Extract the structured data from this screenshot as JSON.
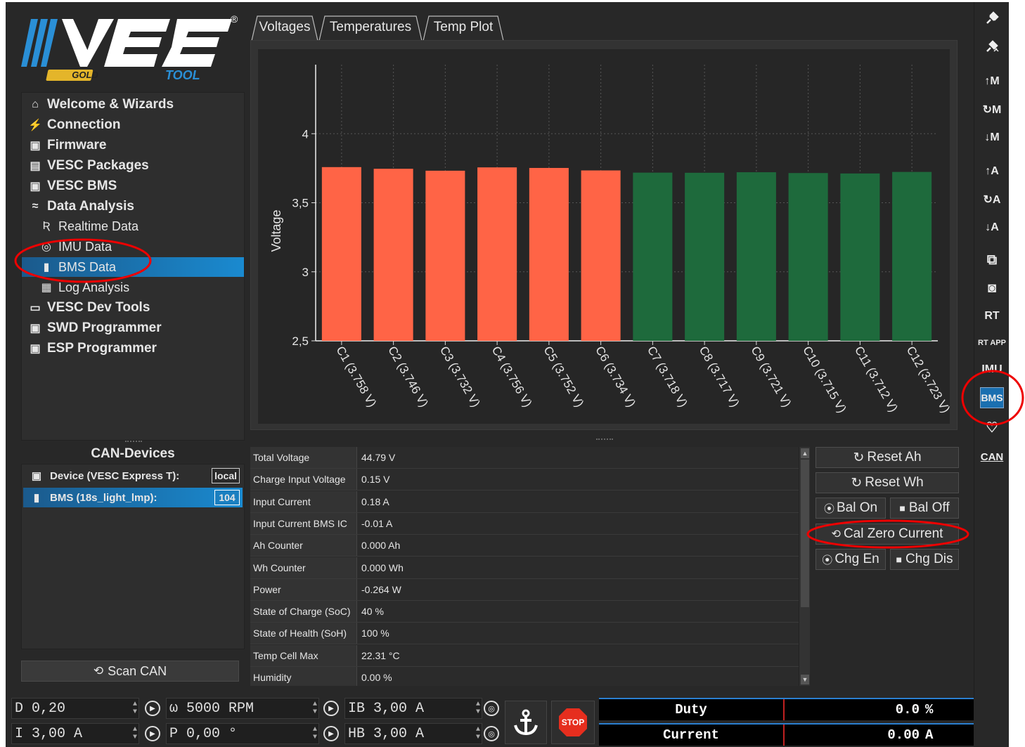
{
  "logo": {
    "brand": "VESC",
    "gold": "GOLD",
    "tool": "TOOL",
    "reg": "®"
  },
  "nav": {
    "items": [
      {
        "label": "Welcome & Wizards",
        "icon": "home-icon",
        "level": "top"
      },
      {
        "label": "Connection",
        "icon": "plug-icon",
        "level": "top"
      },
      {
        "label": "Firmware",
        "icon": "chip-icon",
        "level": "top"
      },
      {
        "label": "VESC Packages",
        "icon": "package-icon",
        "level": "top"
      },
      {
        "label": "VESC BMS",
        "icon": "chip-icon",
        "level": "top"
      },
      {
        "label": "Data Analysis",
        "icon": "chart-icon",
        "level": "top"
      },
      {
        "label": "Realtime Data",
        "icon": "rt-icon",
        "level": "sub"
      },
      {
        "label": "IMU Data",
        "icon": "imu-icon",
        "level": "sub"
      },
      {
        "label": "BMS Data",
        "icon": "battery-icon",
        "level": "sub",
        "selected": true
      },
      {
        "label": "Log Analysis",
        "icon": "map-icon",
        "level": "sub"
      },
      {
        "label": "VESC Dev Tools",
        "icon": "terminal-icon",
        "level": "top"
      },
      {
        "label": "SWD Programmer",
        "icon": "chip-icon",
        "level": "top"
      },
      {
        "label": "ESP Programmer",
        "icon": "chip-icon",
        "level": "top"
      }
    ]
  },
  "can": {
    "title": "CAN-Devices",
    "devices": [
      {
        "label": "Device (VESC Express T):",
        "badge": "local",
        "icon": "chip-icon"
      },
      {
        "label": "BMS (18s_light_lmp):",
        "badge": "104",
        "icon": "battery-icon",
        "selected": true
      }
    ],
    "scan_label": "Scan CAN"
  },
  "tabs": [
    {
      "label": "Voltages",
      "active": true
    },
    {
      "label": "Temperatures"
    },
    {
      "label": "Temp Plot"
    }
  ],
  "chart_data": {
    "type": "bar",
    "ylabel": "Voltage",
    "ylim": [
      2.5,
      4.5
    ],
    "yticks": [
      2.5,
      3,
      3.5,
      4
    ],
    "ytick_labels": [
      "2,5",
      "3",
      "3,5",
      "4"
    ],
    "grid": true,
    "categories": [
      "C1 (3.758 V)",
      "C2 (3.746 V)",
      "C3 (3.732 V)",
      "C4 (3.756 V)",
      "C5 (3.752 V)",
      "C6 (3.734 V)",
      "C7 (3.718 V)",
      "C8 (3.717 V)",
      "C9 (3.721 V)",
      "C10 (3.715 V)",
      "C11 (3.712 V)",
      "C12 (3.723 V)"
    ],
    "values": [
      3.758,
      3.746,
      3.732,
      3.756,
      3.752,
      3.734,
      3.718,
      3.717,
      3.721,
      3.715,
      3.712,
      3.723
    ],
    "balancing": [
      true,
      true,
      true,
      true,
      true,
      true,
      false,
      false,
      false,
      false,
      false,
      false
    ],
    "colors": {
      "balancing": "#ff6446",
      "normal": "#1e6a3c"
    }
  },
  "table": {
    "rows": [
      {
        "key": "Total Voltage",
        "value": "44.79 V"
      },
      {
        "key": "Charge Input Voltage",
        "value": "0.15 V"
      },
      {
        "key": "Input Current",
        "value": "0.18 A"
      },
      {
        "key": "Input Current BMS IC",
        "value": "-0.01 A"
      },
      {
        "key": "Ah Counter",
        "value": "0.000 Ah"
      },
      {
        "key": "Wh Counter",
        "value": "0.000 Wh"
      },
      {
        "key": "Power",
        "value": "-0.264 W"
      },
      {
        "key": "State of Charge (SoC)",
        "value": "40 %"
      },
      {
        "key": "State of Health (SoH)",
        "value": "100 %"
      },
      {
        "key": "Temp Cell Max",
        "value": "22.31 °C"
      },
      {
        "key": "Humidity",
        "value": "0.00 %"
      }
    ]
  },
  "buttons": {
    "reset_ah": "Reset Ah",
    "reset_wh": "Reset Wh",
    "bal_on": "Bal On",
    "bal_off": "Bal Off",
    "cal_zero": "Cal Zero Current",
    "chg_en": "Chg En",
    "chg_dis": "Chg Dis"
  },
  "toolbar": {
    "labels": [
      "↑M",
      "↻M",
      "↓M",
      "↑A",
      "↻A",
      "↓A",
      "RT",
      "RT APP",
      "IMU",
      "BMS",
      "CAN"
    ]
  },
  "bottom": {
    "duty_input": "D 0,20",
    "rpm_input": "ω 5000 RPM",
    "ib_input": "IB 3,00 A",
    "current_input": "I 3,00 A",
    "pos_input": "P 0,00 °",
    "hb_input": "HB 3,00 A",
    "stop_label": "STOP",
    "gauges": [
      {
        "label": "Duty",
        "value": "0.0",
        "unit": "%"
      },
      {
        "label": "Current",
        "value": "0.00",
        "unit": "A"
      }
    ]
  }
}
